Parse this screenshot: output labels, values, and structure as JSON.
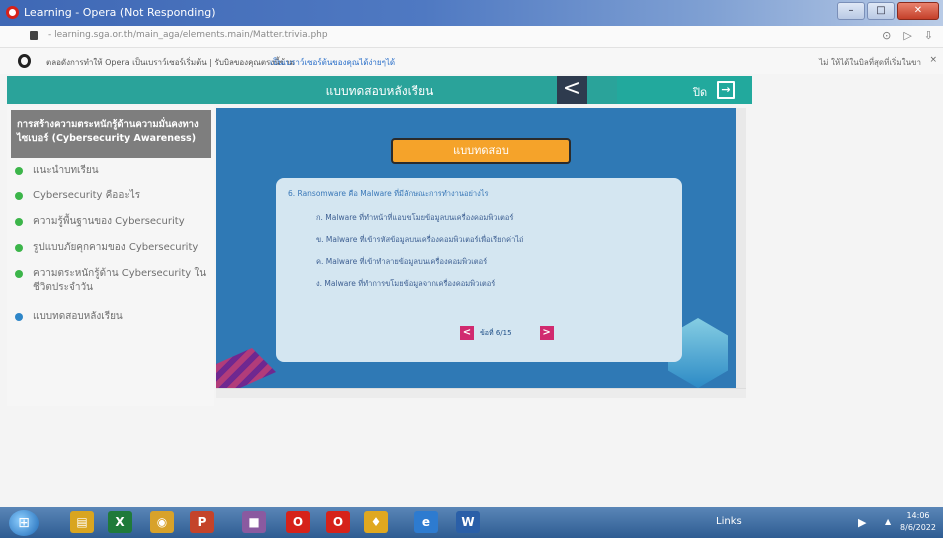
{
  "window": {
    "title": "Learning - Opera (Not Responding)",
    "buttons": {
      "minimize": "–",
      "maximize": "□",
      "close": "✕"
    }
  },
  "address": {
    "url": "- learning.sga.or.th/main_aga/elements.main/Matter.trivia.php",
    "icons": [
      "refresh-icon",
      "play-icon",
      "download-icon"
    ]
  },
  "infobar": {
    "text": "ตลอดังการทำให้ Opera เป็นเบราว์เซอร์เริ่มต้น | รับบิลของคุณตรงนี้ข้าม",
    "link": "เป็นเบราว์เซอร์ต้นของคุณได้ง่ายๆได้",
    "right_text": "ไม่ ให้ได้ในบิลที่สุดที่เริ่มในขา",
    "close": "×"
  },
  "header": {
    "title": "แบบทดสอบหลังเรียน",
    "back_symbol": "<",
    "exit_label": "ปิด",
    "exit_symbol": "→"
  },
  "sidebar": {
    "course_title": "การสร้างความตระหนักรู้ด้านความมั่นคงทางไซเบอร์ (Cybersecurity Awareness)",
    "items": [
      {
        "label": "แนะนำบทเรียน",
        "status": "green"
      },
      {
        "label": "Cybersecurity คืออะไร",
        "status": "green"
      },
      {
        "label": "ความรู้พื้นฐานของ Cybersecurity",
        "status": "green"
      },
      {
        "label": "รูปแบบภัยคุกคามของ Cybersecurity",
        "status": "green"
      },
      {
        "label": "ความตระหนักรู้ด้าน Cybersecurity ในชีวิตประจำวัน",
        "status": "green"
      },
      {
        "label": "แบบทดสอบหลังเรียน",
        "status": "blue"
      }
    ]
  },
  "quiz": {
    "badge": "แบบทดสอบ",
    "question": "6. Ransomware คือ Malware ที่มีลักษณะการทำงานอย่างไร",
    "choices": [
      "ก. Malware ที่ทำหน้าที่แอบขโมยข้อมูลบนเครื่องคอมพิวเตอร์",
      "ข. Malware ที่เข้ารหัสข้อมูลบนเครื่องคอมพิวเตอร์เพื่อเรียกค่าไถ่",
      "ค. Malware ที่เข้าทำลายข้อมูลบนเครื่องคอมพิวเตอร์",
      "ง. Malware ที่ทำการขโมยข้อมูลจากเครื่องคอมพิวเตอร์"
    ],
    "pager": {
      "prev": "<",
      "text": "ข้อที่ 6/15",
      "next": ">"
    }
  },
  "taskbar": {
    "start": "⊞",
    "apps": [
      {
        "name": "explorer",
        "glyph": "▤",
        "color": "#d9a520"
      },
      {
        "name": "excel",
        "glyph": "X",
        "color": "#1f7a3a"
      },
      {
        "name": "chrome",
        "glyph": "◉",
        "color": "#d8a22a"
      },
      {
        "name": "powerpoint",
        "glyph": "P",
        "color": "#c4432a"
      },
      {
        "name": "app",
        "glyph": "■",
        "color": "#8a5aa0"
      },
      {
        "name": "opera",
        "glyph": "O",
        "color": "#d6221a"
      },
      {
        "name": "opera-active",
        "glyph": "O",
        "color": "#d6221a"
      },
      {
        "name": "shield",
        "glyph": "♦",
        "color": "#e0a81f"
      },
      {
        "name": "ie",
        "glyph": "e",
        "color": "#2d7bd0"
      },
      {
        "name": "word",
        "glyph": "W",
        "color": "#2a5fa8"
      }
    ],
    "links_label": "Links",
    "tray_flag": "▶",
    "tray_arrow": "▲",
    "time": "14:06",
    "date": "8/6/2022"
  }
}
